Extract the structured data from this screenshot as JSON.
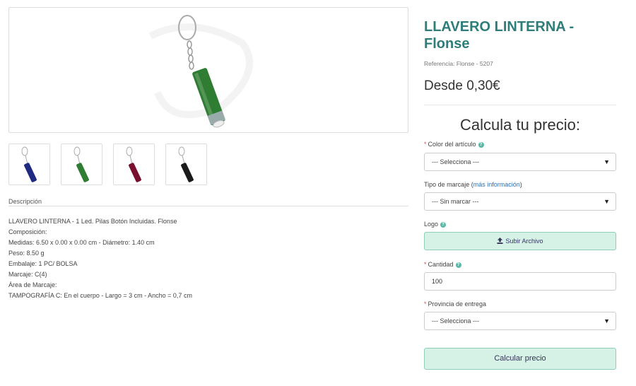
{
  "product": {
    "title": "LLAVERO LINTERNA - Flonse",
    "reference": "Referencia: Flonse - 5207",
    "price": "Desde 0,30€"
  },
  "gallery": {
    "main_color": "#2f7d32",
    "thumbnails": [
      {
        "color": "#1f2a80"
      },
      {
        "color": "#2f7d32"
      },
      {
        "color": "#7a1030"
      },
      {
        "color": "#1a1a1a"
      }
    ]
  },
  "description": {
    "tab_label": "Descripción",
    "lines": [
      "LLAVERO LINTERNA - 1 Led. Pilas Botón Incluidas. Flonse",
      "Composición:",
      "Medidas: 6.50 x 0.00 x 0.00 cm - Diámetro: 1.40 cm",
      "Peso: 8.50 g",
      "Embalaje: 1 PC/ BOLSA",
      "Marcaje: C(4)",
      "Área de Marcaje:",
      "TAMPOGRAFÍA C: En el cuerpo - Largo = 3 cm - Ancho = 0,7 cm"
    ]
  },
  "calculator": {
    "title": "Calcula tu precio:",
    "color": {
      "label": "Color del artículo",
      "value": "--- Selecciona ---"
    },
    "marking": {
      "label": "Tipo de marcaje (",
      "link": "más información",
      "label_end": ")",
      "value": "--- Sin marcar ---"
    },
    "logo": {
      "label": "Logo",
      "button": "Subir Archivo"
    },
    "quantity": {
      "label": "Cantidad",
      "value": "100"
    },
    "province": {
      "label": "Provincia de entrega",
      "value": "--- Selecciona ---"
    },
    "submit": "Calcular precio"
  },
  "colors": {
    "accent": "#2e7d7b",
    "button_bg": "#d6f2e6",
    "required": "#d9534f"
  }
}
